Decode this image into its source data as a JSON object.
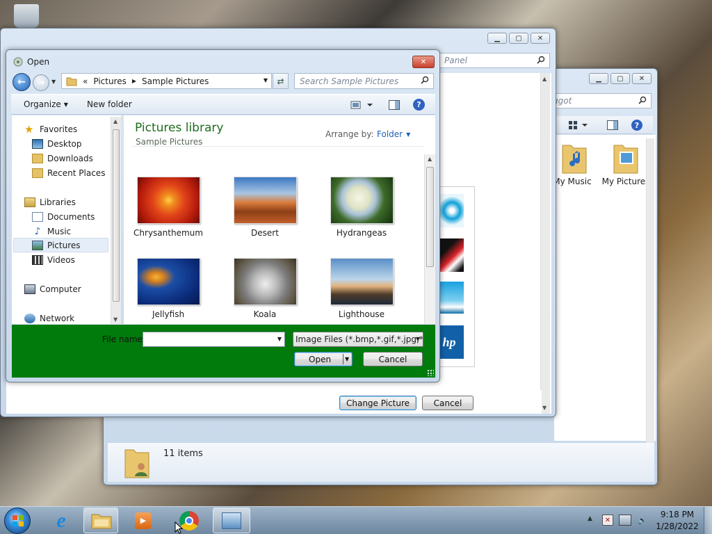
{
  "back_window_2": {
    "search_text": "ggot",
    "items": [
      "My Music",
      "My Pictures"
    ],
    "status_count": "11 items"
  },
  "back_window_1": {
    "search_text": "Panel",
    "change_picture_label": "Change Picture",
    "cancel_label": "Cancel"
  },
  "dialog": {
    "title": "Open",
    "breadcrumb": [
      "«",
      "Pictures",
      "Sample Pictures"
    ],
    "search_placeholder": "Search Sample Pictures",
    "toolbar": {
      "organize": "Organize",
      "new_folder": "New folder"
    },
    "nav": {
      "favorites": "Favorites",
      "desktop": "Desktop",
      "downloads": "Downloads",
      "recent": "Recent Places",
      "libraries": "Libraries",
      "documents": "Documents",
      "music": "Music",
      "pictures": "Pictures",
      "videos": "Videos",
      "computer": "Computer",
      "network": "Network"
    },
    "library_title": "Pictures library",
    "library_subtitle": "Sample Pictures",
    "arrange_label": "Arrange by:",
    "arrange_value": "Folder",
    "files": [
      "Chrysanthemum",
      "Desert",
      "Hydrangeas",
      "Jellyfish",
      "Koala",
      "Lighthouse"
    ],
    "filename_label": "File name:",
    "filename_value": "",
    "filetype_value": "Image Files (*.bmp,*.gif,*.jpg,*.",
    "open_label": "Open",
    "cancel_label": "Cancel",
    "footer_color": "#007b0c"
  },
  "taskbar": {
    "time": "9:18 PM",
    "date": "1/28/2022"
  }
}
